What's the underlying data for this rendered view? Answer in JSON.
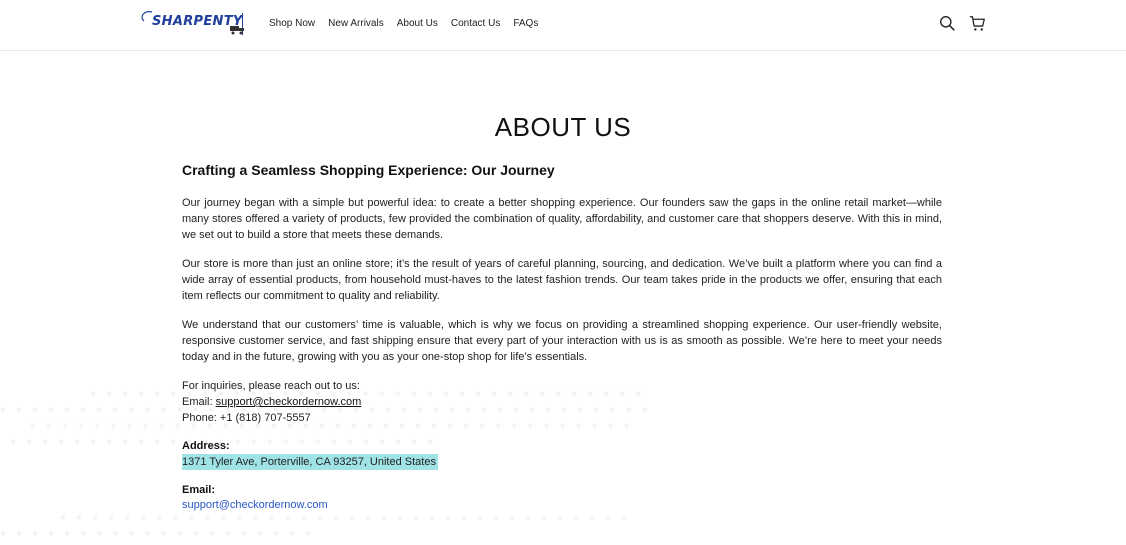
{
  "header": {
    "logo_text": "SHARPENTY",
    "nav": [
      "Shop Now",
      "New Arrivals",
      "About Us",
      "Contact Us",
      "FAQs"
    ],
    "icons": [
      "search-icon",
      "cart-icon"
    ]
  },
  "page": {
    "title": "ABOUT US",
    "subhead": "Crafting a Seamless Shopping Experience: Our Journey",
    "paragraphs": [
      "Our journey began with a simple but powerful idea: to create a better shopping experience. Our founders saw the gaps in the online retail market—while many stores offered a variety of products, few provided the combination of quality, affordability, and customer care that shoppers deserve. With this in mind, we set out to build a store that meets these demands.",
      "Our store is more than just an online store; it’s the result of years of careful planning, sourcing, and dedication. We’ve built a platform where you can find a wide array of essential products, from household must-haves to the latest fashion trends. Our team takes pride in the products we offer, ensuring that each item reflects our commitment to quality and reliability.",
      "We understand that our customers’ time is valuable, which is why we focus on providing a streamlined shopping experience. Our user-friendly website, responsive customer service, and fast shipping ensure that every part of your interaction with us is as smooth as possible. We’re here to meet your needs today and in the future, growing with you as your one-stop shop for life’s essentials."
    ],
    "inquiry_intro": "For inquiries, please reach out to us:",
    "email_prefix": "Email: ",
    "email_link": "support@checkordernow.com",
    "phone_line": "Phone: +1 (818) 707-5557",
    "address_label": "Address:",
    "address_value": "1371 Tyler Ave, Porterville, CA 93257, United States",
    "email_label": "Email:",
    "email_value": "support@checkordernow.com"
  },
  "colors": {
    "brand": "#1f3f9a",
    "highlight": "#9fe3e6",
    "link_blue": "#2a56c6"
  }
}
